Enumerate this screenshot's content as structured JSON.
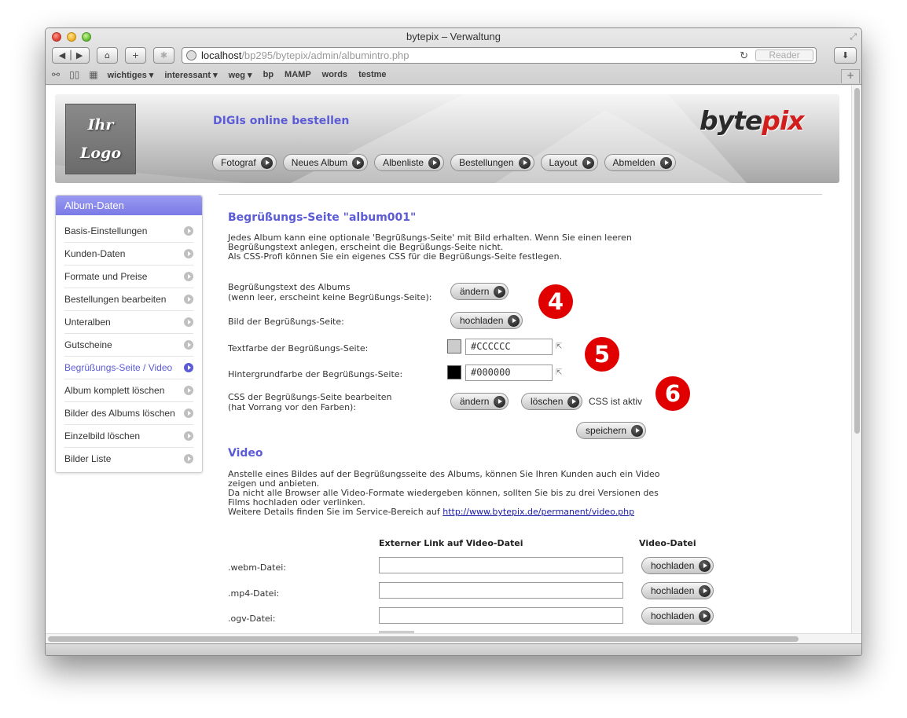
{
  "browser": {
    "title": "bytepix – Verwaltung",
    "url_host": "localhost",
    "url_path": "/bp295/bytepix/admin/albumintro.php",
    "reader_label": "Reader",
    "bookmarks": [
      "wichtiges ▾",
      "interessant ▾",
      "weg ▾",
      "bp",
      "MAMP",
      "words",
      "testme"
    ]
  },
  "header": {
    "logo_line1": "Ihr",
    "logo_line2": "Logo",
    "title": "DIGIs online bestellen",
    "brand_main": "byte",
    "brand_accent": "pix",
    "nav": [
      "Fotograf",
      "Neues Album",
      "Albenliste",
      "Bestellungen",
      "Layout",
      "Abmelden"
    ]
  },
  "sidebar": {
    "heading": "Album-Daten",
    "items": [
      "Basis-Einstellungen",
      "Kunden-Daten",
      "Formate und Preise",
      "Bestellungen bearbeiten",
      "Unteralben",
      "Gutscheine",
      "Begrüßungs-Seite / Video",
      "Album komplett löschen",
      "Bilder des Albums löschen",
      "Einzelbild löschen",
      "Bilder Liste"
    ],
    "active_index": 6
  },
  "welcome": {
    "heading": "Begrüßungs-Seite \"album001\"",
    "intro_line1": "Jedes Album kann eine optionale 'Begrüßungs-Seite' mit Bild erhalten. Wenn Sie einen leeren",
    "intro_line2": "Begrüßungstext anlegen, erscheint die Begrüßungs-Seite nicht.",
    "intro_line3": "Als CSS-Profi können Sie ein eigenes CSS für die Begrüßungs-Seite festlegen.",
    "text_label_line1": "Begrüßungstext des Albums",
    "text_label_line2": "(wenn leer, erscheint keine Begrüßungs-Seite):",
    "text_button": "ändern",
    "image_label": "Bild der Begrüßungs-Seite:",
    "image_button": "hochladen",
    "textcolor_label": "Textfarbe der Begrüßungs-Seite:",
    "textcolor_value": "#CCCCCC",
    "bgcolor_label": "Hintergrundfarbe der Begrüßungs-Seite:",
    "bgcolor_value": "#000000",
    "css_label_line1": "CSS der Begrüßungs-Seite bearbeiten",
    "css_label_line2": "(hat Vorrang vor den Farben):",
    "css_edit_button": "ändern",
    "css_delete_button": "löschen",
    "css_status": "CSS ist aktiv",
    "save_button": "speichern",
    "badges": [
      "4",
      "5",
      "6"
    ]
  },
  "video": {
    "heading": "Video",
    "desc_line1": "Anstelle eines Bildes auf der Begrüßungsseite des Albums, können Sie Ihren Kunden auch ein Video",
    "desc_line2": "zeigen und anbieten.",
    "desc_line3": "Da nicht alle Browser alle Video-Formate wiedergeben können, sollten Sie bis zu drei Versionen des",
    "desc_line4": "Films hochladen oder verlinken.",
    "desc_line5_prefix": "Weitere Details finden Sie im Service-Bereich auf ",
    "desc_link": "http://www.bytepix.de/permanent/video.php",
    "col_link": "Externer Link auf Video-Datei",
    "col_file": "Video-Datei",
    "rows": [
      {
        "label": ".webm-Datei:",
        "button": "hochladen"
      },
      {
        "label": ".mp4-Datei:",
        "button": "hochladen"
      },
      {
        "label": ".ogv-Datei:",
        "button": "hochladen"
      }
    ]
  },
  "colors": {
    "accent": "#5b5bd6",
    "badge": "#e10000",
    "textcolor_swatch": "#CCCCCC",
    "bgcolor_swatch": "#000000"
  }
}
